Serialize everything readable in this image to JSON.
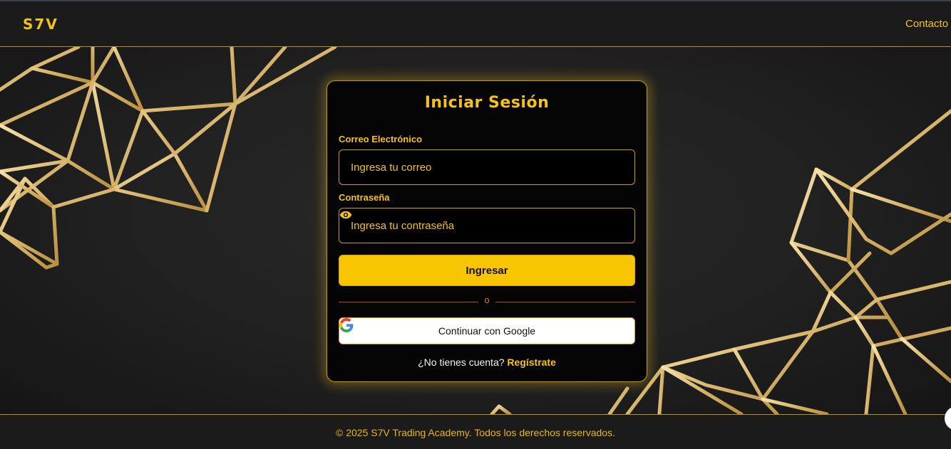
{
  "header": {
    "logo": "S7V",
    "nav_contact": "Contacto"
  },
  "login": {
    "title": "Iniciar Sesión",
    "email_label": "Correo Electrónico",
    "email_placeholder": "Ingresa tu correo",
    "password_label": "Contraseña",
    "password_placeholder": "Ingresa tu contraseña",
    "submit_label": "Ingresar",
    "divider_text": "o",
    "google_label": "Continuar con Google",
    "signup_prompt": "¿No tienes cuenta?",
    "signup_link": "Regístrate"
  },
  "footer": {
    "text": "© 2025 S7V Trading Academy. Todos los derechos reservados."
  },
  "icons": {
    "password_toggle": "eye-icon",
    "google": "google-logo-icon"
  },
  "colors": {
    "accent": "#f5c21b",
    "button": "#f8c503",
    "background": "#1a1a1a",
    "card": "#050505"
  }
}
